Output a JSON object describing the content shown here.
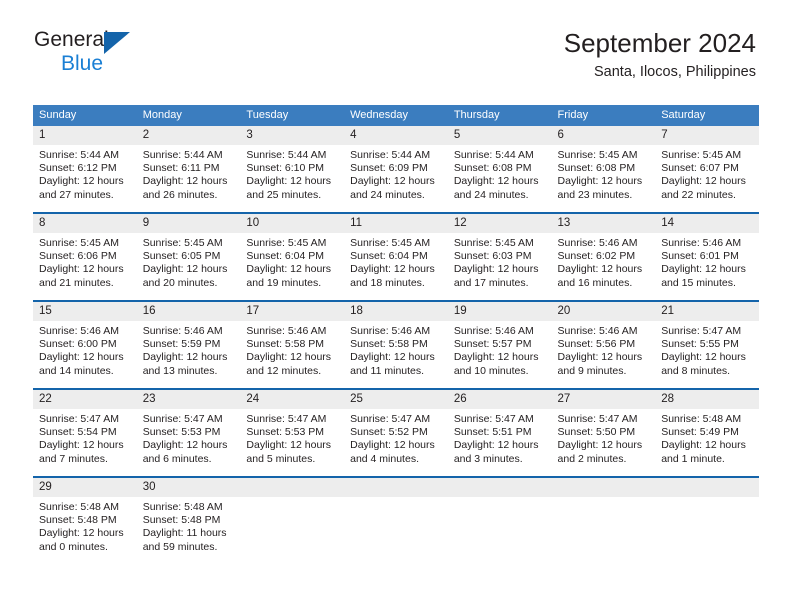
{
  "brand": {
    "name_part1": "General",
    "name_part2": "Blue",
    "accent_color": "#1a7fd4",
    "triangle_color": "#1464aa",
    "triangle_icon": "brand-triangle-icon"
  },
  "header": {
    "title": "September 2024",
    "subtitle": "Santa, Ilocos, Philippines"
  },
  "calendar": {
    "header_bg": "#3b7dbf",
    "row_separator_color": "#1464aa",
    "date_strip_bg": "#ededed",
    "weekdays": [
      "Sunday",
      "Monday",
      "Tuesday",
      "Wednesday",
      "Thursday",
      "Friday",
      "Saturday"
    ],
    "weeks": [
      [
        {
          "day": "1",
          "sunrise": "Sunrise: 5:44 AM",
          "sunset": "Sunset: 6:12 PM",
          "daylight_line1": "Daylight: 12 hours",
          "daylight_line2": "and 27 minutes."
        },
        {
          "day": "2",
          "sunrise": "Sunrise: 5:44 AM",
          "sunset": "Sunset: 6:11 PM",
          "daylight_line1": "Daylight: 12 hours",
          "daylight_line2": "and 26 minutes."
        },
        {
          "day": "3",
          "sunrise": "Sunrise: 5:44 AM",
          "sunset": "Sunset: 6:10 PM",
          "daylight_line1": "Daylight: 12 hours",
          "daylight_line2": "and 25 minutes."
        },
        {
          "day": "4",
          "sunrise": "Sunrise: 5:44 AM",
          "sunset": "Sunset: 6:09 PM",
          "daylight_line1": "Daylight: 12 hours",
          "daylight_line2": "and 24 minutes."
        },
        {
          "day": "5",
          "sunrise": "Sunrise: 5:44 AM",
          "sunset": "Sunset: 6:08 PM",
          "daylight_line1": "Daylight: 12 hours",
          "daylight_line2": "and 24 minutes."
        },
        {
          "day": "6",
          "sunrise": "Sunrise: 5:45 AM",
          "sunset": "Sunset: 6:08 PM",
          "daylight_line1": "Daylight: 12 hours",
          "daylight_line2": "and 23 minutes."
        },
        {
          "day": "7",
          "sunrise": "Sunrise: 5:45 AM",
          "sunset": "Sunset: 6:07 PM",
          "daylight_line1": "Daylight: 12 hours",
          "daylight_line2": "and 22 minutes."
        }
      ],
      [
        {
          "day": "8",
          "sunrise": "Sunrise: 5:45 AM",
          "sunset": "Sunset: 6:06 PM",
          "daylight_line1": "Daylight: 12 hours",
          "daylight_line2": "and 21 minutes."
        },
        {
          "day": "9",
          "sunrise": "Sunrise: 5:45 AM",
          "sunset": "Sunset: 6:05 PM",
          "daylight_line1": "Daylight: 12 hours",
          "daylight_line2": "and 20 minutes."
        },
        {
          "day": "10",
          "sunrise": "Sunrise: 5:45 AM",
          "sunset": "Sunset: 6:04 PM",
          "daylight_line1": "Daylight: 12 hours",
          "daylight_line2": "and 19 minutes."
        },
        {
          "day": "11",
          "sunrise": "Sunrise: 5:45 AM",
          "sunset": "Sunset: 6:04 PM",
          "daylight_line1": "Daylight: 12 hours",
          "daylight_line2": "and 18 minutes."
        },
        {
          "day": "12",
          "sunrise": "Sunrise: 5:45 AM",
          "sunset": "Sunset: 6:03 PM",
          "daylight_line1": "Daylight: 12 hours",
          "daylight_line2": "and 17 minutes."
        },
        {
          "day": "13",
          "sunrise": "Sunrise: 5:46 AM",
          "sunset": "Sunset: 6:02 PM",
          "daylight_line1": "Daylight: 12 hours",
          "daylight_line2": "and 16 minutes."
        },
        {
          "day": "14",
          "sunrise": "Sunrise: 5:46 AM",
          "sunset": "Sunset: 6:01 PM",
          "daylight_line1": "Daylight: 12 hours",
          "daylight_line2": "and 15 minutes."
        }
      ],
      [
        {
          "day": "15",
          "sunrise": "Sunrise: 5:46 AM",
          "sunset": "Sunset: 6:00 PM",
          "daylight_line1": "Daylight: 12 hours",
          "daylight_line2": "and 14 minutes."
        },
        {
          "day": "16",
          "sunrise": "Sunrise: 5:46 AM",
          "sunset": "Sunset: 5:59 PM",
          "daylight_line1": "Daylight: 12 hours",
          "daylight_line2": "and 13 minutes."
        },
        {
          "day": "17",
          "sunrise": "Sunrise: 5:46 AM",
          "sunset": "Sunset: 5:58 PM",
          "daylight_line1": "Daylight: 12 hours",
          "daylight_line2": "and 12 minutes."
        },
        {
          "day": "18",
          "sunrise": "Sunrise: 5:46 AM",
          "sunset": "Sunset: 5:58 PM",
          "daylight_line1": "Daylight: 12 hours",
          "daylight_line2": "and 11 minutes."
        },
        {
          "day": "19",
          "sunrise": "Sunrise: 5:46 AM",
          "sunset": "Sunset: 5:57 PM",
          "daylight_line1": "Daylight: 12 hours",
          "daylight_line2": "and 10 minutes."
        },
        {
          "day": "20",
          "sunrise": "Sunrise: 5:46 AM",
          "sunset": "Sunset: 5:56 PM",
          "daylight_line1": "Daylight: 12 hours",
          "daylight_line2": "and 9 minutes."
        },
        {
          "day": "21",
          "sunrise": "Sunrise: 5:47 AM",
          "sunset": "Sunset: 5:55 PM",
          "daylight_line1": "Daylight: 12 hours",
          "daylight_line2": "and 8 minutes."
        }
      ],
      [
        {
          "day": "22",
          "sunrise": "Sunrise: 5:47 AM",
          "sunset": "Sunset: 5:54 PM",
          "daylight_line1": "Daylight: 12 hours",
          "daylight_line2": "and 7 minutes."
        },
        {
          "day": "23",
          "sunrise": "Sunrise: 5:47 AM",
          "sunset": "Sunset: 5:53 PM",
          "daylight_line1": "Daylight: 12 hours",
          "daylight_line2": "and 6 minutes."
        },
        {
          "day": "24",
          "sunrise": "Sunrise: 5:47 AM",
          "sunset": "Sunset: 5:53 PM",
          "daylight_line1": "Daylight: 12 hours",
          "daylight_line2": "and 5 minutes."
        },
        {
          "day": "25",
          "sunrise": "Sunrise: 5:47 AM",
          "sunset": "Sunset: 5:52 PM",
          "daylight_line1": "Daylight: 12 hours",
          "daylight_line2": "and 4 minutes."
        },
        {
          "day": "26",
          "sunrise": "Sunrise: 5:47 AM",
          "sunset": "Sunset: 5:51 PM",
          "daylight_line1": "Daylight: 12 hours",
          "daylight_line2": "and 3 minutes."
        },
        {
          "day": "27",
          "sunrise": "Sunrise: 5:47 AM",
          "sunset": "Sunset: 5:50 PM",
          "daylight_line1": "Daylight: 12 hours",
          "daylight_line2": "and 2 minutes."
        },
        {
          "day": "28",
          "sunrise": "Sunrise: 5:48 AM",
          "sunset": "Sunset: 5:49 PM",
          "daylight_line1": "Daylight: 12 hours",
          "daylight_line2": "and 1 minute."
        }
      ],
      [
        {
          "day": "29",
          "sunrise": "Sunrise: 5:48 AM",
          "sunset": "Sunset: 5:48 PM",
          "daylight_line1": "Daylight: 12 hours",
          "daylight_line2": "and 0 minutes."
        },
        {
          "day": "30",
          "sunrise": "Sunrise: 5:48 AM",
          "sunset": "Sunset: 5:48 PM",
          "daylight_line1": "Daylight: 11 hours",
          "daylight_line2": "and 59 minutes."
        },
        {
          "day": "",
          "sunrise": "",
          "sunset": "",
          "daylight_line1": "",
          "daylight_line2": ""
        },
        {
          "day": "",
          "sunrise": "",
          "sunset": "",
          "daylight_line1": "",
          "daylight_line2": ""
        },
        {
          "day": "",
          "sunrise": "",
          "sunset": "",
          "daylight_line1": "",
          "daylight_line2": ""
        },
        {
          "day": "",
          "sunrise": "",
          "sunset": "",
          "daylight_line1": "",
          "daylight_line2": ""
        },
        {
          "day": "",
          "sunrise": "",
          "sunset": "",
          "daylight_line1": "",
          "daylight_line2": ""
        }
      ]
    ]
  }
}
